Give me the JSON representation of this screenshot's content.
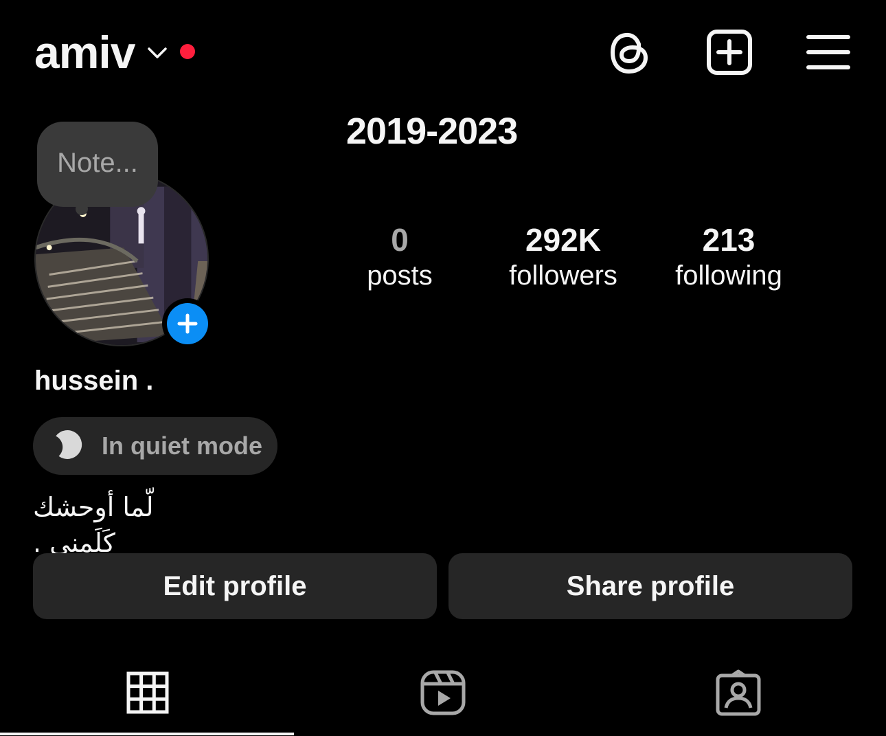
{
  "header": {
    "username": "amiv",
    "icons": [
      "chevron-down-icon",
      "live-dot",
      "threads-icon",
      "new-post-icon",
      "menu-icon"
    ]
  },
  "profile": {
    "bio_title": "2019-2023",
    "note_placeholder": "Note...",
    "full_name": "hussein .",
    "quiet_mode": "In quiet mode",
    "bio": "لّما أوحشك كَلَمني ."
  },
  "stats": {
    "posts": {
      "count": "0",
      "label": "posts"
    },
    "followers": {
      "count": "292K",
      "label": "followers"
    },
    "following": {
      "count": "213",
      "label": "following"
    }
  },
  "buttons": {
    "edit": "Edit profile",
    "share": "Share profile"
  },
  "tabs": {
    "items": [
      "grid-icon",
      "reels-icon",
      "tagged-icon"
    ],
    "active": "grid-icon"
  },
  "colors": {
    "background": "#000000",
    "live_dot": "#ff1f3d",
    "accent_blue": "#0b8ef5",
    "surface": "#262626"
  }
}
